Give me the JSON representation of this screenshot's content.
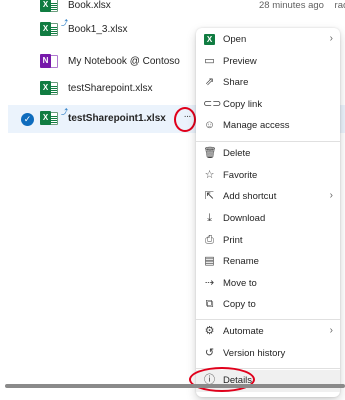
{
  "files": [
    {
      "name": "Book.xlsx",
      "type": "excel",
      "modified": "28 minutes ago",
      "owner": "raoju"
    },
    {
      "name": "Book1_3.xlsx",
      "type": "excel",
      "sync": true
    },
    {
      "name": "My Notebook @ Contoso",
      "type": "onenote"
    },
    {
      "name": "testSharepoint.xlsx",
      "type": "excel"
    },
    {
      "name": "testSharepoint1.xlsx",
      "type": "excel",
      "selected": true,
      "sync": true
    }
  ],
  "more_button_label": "···",
  "menu": {
    "items": [
      {
        "label": "Open",
        "icon": "excel-icon",
        "submenu": true
      },
      {
        "label": "Preview",
        "icon": "preview-icon"
      },
      {
        "label": "Share",
        "icon": "share-icon"
      },
      {
        "label": "Copy link",
        "icon": "link-icon"
      },
      {
        "label": "Manage access",
        "icon": "person-key-icon"
      },
      {
        "label": "Delete",
        "icon": "trash-icon"
      },
      {
        "label": "Favorite",
        "icon": "star-icon"
      },
      {
        "label": "Add shortcut",
        "icon": "shortcut-icon",
        "submenu": true
      },
      {
        "label": "Download",
        "icon": "download-icon"
      },
      {
        "label": "Print",
        "icon": "print-icon"
      },
      {
        "label": "Rename",
        "icon": "rename-icon"
      },
      {
        "label": "Move to",
        "icon": "move-icon"
      },
      {
        "label": "Copy to",
        "icon": "copy-icon"
      },
      {
        "label": "Automate",
        "icon": "automate-icon",
        "submenu": true
      },
      {
        "label": "Version history",
        "icon": "history-icon"
      },
      {
        "label": "Details",
        "icon": "details-icon",
        "highlighted": true
      }
    ]
  },
  "colors": {
    "accent": "#0f6cbd",
    "excel": "#107c41",
    "onenote": "#7719aa",
    "annotation": "#e0001b"
  }
}
